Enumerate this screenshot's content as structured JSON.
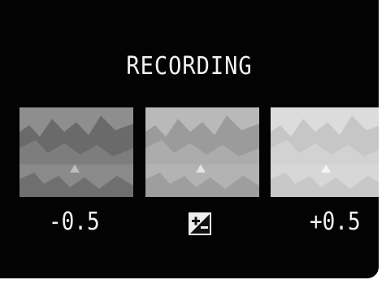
{
  "screen": {
    "title": "RECORDING",
    "brackets": [
      {
        "label": "-0.5",
        "icon": "landscape-thumbnail-dark"
      },
      {
        "label": "",
        "icon": "exposure-compensation-icon"
      },
      {
        "label": "+0.5",
        "icon": "landscape-thumbnail-bright"
      }
    ]
  },
  "colors": {
    "background": "#030303",
    "text": "#f2f2f2"
  }
}
